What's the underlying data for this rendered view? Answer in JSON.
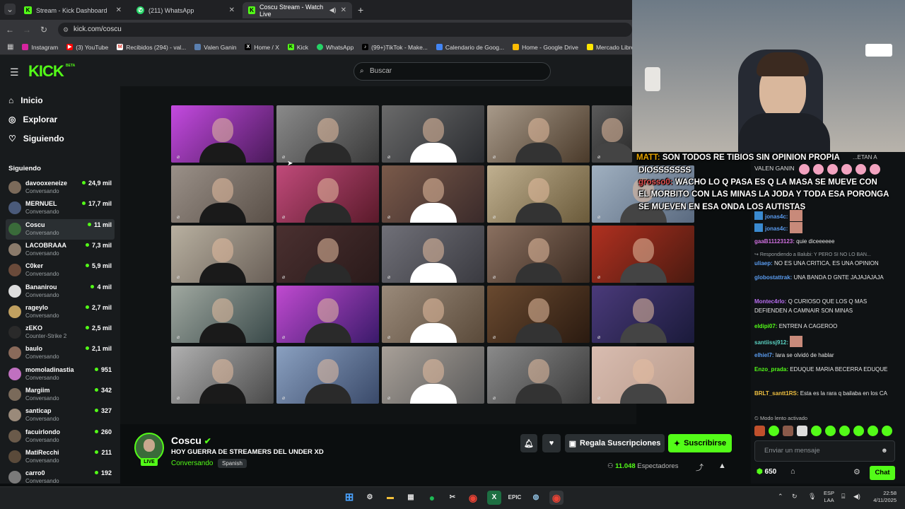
{
  "tabs": [
    {
      "title": "Stream - Kick Dashboard",
      "active": false
    },
    {
      "title": "(211) WhatsApp",
      "active": false
    },
    {
      "title": "Coscu Stream - Watch Live",
      "active": true
    }
  ],
  "url": "kick.com/coscu",
  "bookmarks": [
    "Instagram",
    "(3) YouTube",
    "Recibidos (294) - val...",
    "Valen Ganin",
    "Home / X",
    "Kick",
    "WhatsApp",
    "(99+)TikTok - Make...",
    "Calendario de Goog...",
    "Home - Google Drive",
    "Mercado Libre Arge..."
  ],
  "header": {
    "logo": "KICK",
    "beta": "BETA",
    "search_placeholder": "Buscar"
  },
  "nav": {
    "home": "Inicio",
    "explore": "Explorar",
    "following": "Siguiendo"
  },
  "sidebar": {
    "section_title": "Siguiendo",
    "channels": [
      {
        "name": "davooxeneize",
        "category": "Conversando",
        "viewers": "24,9 mil"
      },
      {
        "name": "MERNUEL",
        "category": "Conversando",
        "viewers": "17,7 mil"
      },
      {
        "name": "Coscu",
        "category": "Conversando",
        "viewers": "11 mil"
      },
      {
        "name": "LACOBRAAA",
        "category": "Conversando",
        "viewers": "7,3 mil"
      },
      {
        "name": "C0ker",
        "category": "Conversando",
        "viewers": "5,9 mil"
      },
      {
        "name": "Bananirou",
        "category": "Conversando",
        "viewers": "4 mil"
      },
      {
        "name": "rageylo",
        "category": "Conversando",
        "viewers": "2,7 mil"
      },
      {
        "name": "zEKO",
        "category": "Counter-Strike 2",
        "viewers": "2,5 mil"
      },
      {
        "name": "baulo",
        "category": "Conversando",
        "viewers": "2,1 mil"
      },
      {
        "name": "momoladinastia",
        "category": "Conversando",
        "viewers": "951"
      },
      {
        "name": "Margiim",
        "category": "Conversando",
        "viewers": "342"
      },
      {
        "name": "santicap",
        "category": "Conversando",
        "viewers": "327"
      },
      {
        "name": "facuirlondo",
        "category": "Conversando",
        "viewers": "260"
      },
      {
        "name": "MatiRecchi",
        "category": "Conversando",
        "viewers": "211"
      },
      {
        "name": "carro0",
        "category": "Conversando",
        "viewers": "192"
      }
    ]
  },
  "overlay": {
    "line1": "SON TODOS RE TIBIOS SIN OPINION PROPIA",
    "line1_user": "MATT:",
    "line2": "DIOSSSSSSS",
    "line3_user": "grosso0:",
    "line3": "WACHO LO Q PASA ES Q LA MASA SE MUEVE CON",
    "line4": "EL MORBITO CON LAS MINAS LA JODA Y TODA ESA PORONGA",
    "line5": "SE MUEVEN EN ESA ONDA LOS AUTISTAS",
    "side1": "...ETAN A",
    "side2": "VALEN GANIN"
  },
  "chat": {
    "messages": [
      {
        "user": "jonas4c:",
        "text": ""
      },
      {
        "user": "jonas4c:",
        "text": ""
      },
      {
        "user": "gaaB11123123:",
        "text": "quie diceeeeee"
      },
      {
        "user": "",
        "text": "Respondiendo a Balubi: Y PERO SI NO LO BAN..."
      },
      {
        "user": "uliaep:",
        "text": "NO ES UNA CRITICA, ES UNA OPINION"
      },
      {
        "user": "globostattrak:",
        "text": "UNA BANDA D GNTE JAJAJAJAJA"
      },
      {
        "user": "Montec4rlo:",
        "text": "Q CURIOSO QUE LOS Q MAS DEFIENDEN A CAMNAIR SON MINAS"
      },
      {
        "user": "eldipi07:",
        "text": "ENTREN A CAGEROO"
      },
      {
        "user": "santiissj912:",
        "text": ""
      },
      {
        "user": "elhiel7:",
        "text": "lara se olvidó de hablar"
      },
      {
        "user": "Enzo_prada:",
        "text": "EDUQUE MARIA BECERRA EDUQUE"
      },
      {
        "user": "BRLT_santt1RS:",
        "text": "Esta es la rara q bailaba en los CA"
      }
    ],
    "slow_mode": "Modo lento activado",
    "input_placeholder": "Enviar un mensaje",
    "points": "650",
    "chat_button": "Chat"
  },
  "stream": {
    "channel": "Coscu",
    "title": "HOY GUERRA DE STREAMERS DEL UNDER XD",
    "category": "Conversando",
    "language": "Spanish",
    "live_badge": "LIVE",
    "viewers": "11.048",
    "viewers_label": "Espectadores",
    "gift_label": "Regala Suscripciones",
    "subscribe_label": "Suscribirse"
  },
  "taskbar": {
    "lang": "ESP",
    "lang2": "LAA",
    "time": "22:58",
    "date": "4/11/2025"
  },
  "colors": {
    "accent": "#53fc18",
    "bg": "#0b0e0f",
    "sidebar": "#181b1d"
  }
}
